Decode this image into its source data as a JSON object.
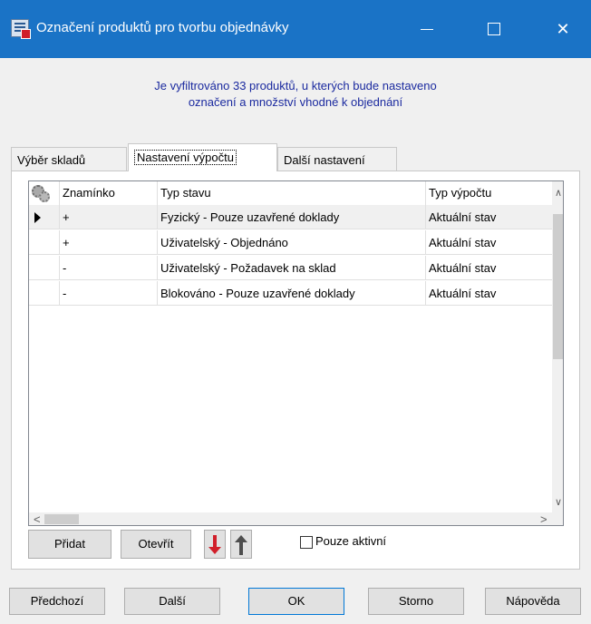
{
  "window": {
    "title": "Označení produktů pro tvorbu objednávky",
    "title_color": "#1a73c6",
    "controls": {
      "minimize": "—",
      "maximize": "☐",
      "close": "✕"
    }
  },
  "info": {
    "line1": "Je vyfiltrováno 33 produktů, u kterých bude nastaveno",
    "line2": "označení a množství vhodné k objednání",
    "color": "#1b2a9f"
  },
  "tabs": [
    {
      "label": "Výběr skladů"
    },
    {
      "label": "Nastavení výpočtu",
      "active": true
    },
    {
      "label": "Další nastavení"
    }
  ],
  "grid": {
    "columns": [
      "Znamínko",
      "Typ stavu",
      "Typ výpočtu"
    ],
    "rows": [
      {
        "sign": "+",
        "state": "Fyzický - Pouze uzavřené doklady",
        "calc": "Aktuální stav",
        "selected": true
      },
      {
        "sign": "+",
        "state": "Uživatelský - Objednáno",
        "calc": "Aktuální stav"
      },
      {
        "sign": "-",
        "state": "Uživatelský - Požadavek na sklad",
        "calc": "Aktuální stav"
      },
      {
        "sign": "-",
        "state": "Blokováno - Pouze uzavřené doklady",
        "calc": "Aktuální stav"
      }
    ],
    "scroll_icons": {
      "up": "∧",
      "down": "∨",
      "left": "<",
      "right": ">"
    }
  },
  "panel_buttons": {
    "add": "Přidat",
    "open": "Otevřít",
    "move_down_icon": "arrow-down-icon",
    "move_up_icon": "arrow-up-icon",
    "only_active": "Pouze aktivní"
  },
  "footer": {
    "prev": "Předchozí",
    "next": "Další",
    "ok": "OK",
    "cancel": "Storno",
    "help": "Nápověda"
  }
}
